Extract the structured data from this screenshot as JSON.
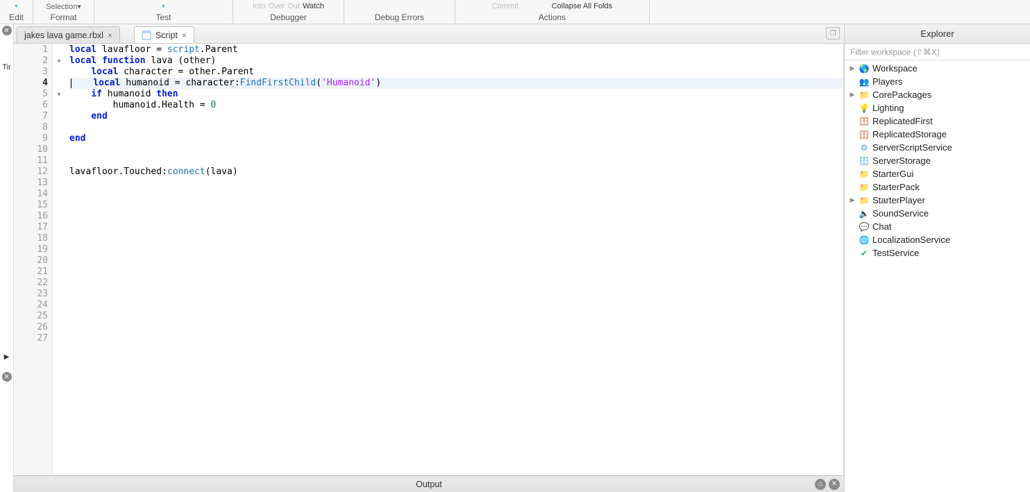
{
  "toolbar": {
    "groups": [
      {
        "label": "Edit",
        "icons": [
          "▾"
        ]
      },
      {
        "label": "Format",
        "icons": [
          "Selection▾"
        ]
      },
      {
        "label": "Test",
        "icons": [
          "▾"
        ]
      },
      {
        "label": "Debugger",
        "icons": [
          "Into",
          "Over",
          "Out",
          "Watch"
        ]
      },
      {
        "label": "Debug Errors",
        "icons": [
          ""
        ]
      },
      {
        "label": "Actions",
        "icons": [
          "Commit",
          "",
          "Collapse All Folds"
        ]
      }
    ]
  },
  "tabs": [
    {
      "label": "jakes lava game.rbxl",
      "active": false,
      "icon": "file"
    },
    {
      "label": "Script",
      "active": true,
      "icon": "script"
    }
  ],
  "leftRailText": "Tir",
  "code": {
    "currentLine": 4,
    "foldMarkers": {
      "2": "▼",
      "5": "▼"
    },
    "lines": [
      {
        "n": 1,
        "tokens": [
          [
            "kw",
            "local"
          ],
          [
            "id",
            " lavafloor "
          ],
          [
            "id",
            "= "
          ],
          [
            "mtd",
            "script"
          ],
          [
            "id",
            ".Parent"
          ]
        ]
      },
      {
        "n": 2,
        "tokens": [
          [
            "kw",
            "local function"
          ],
          [
            "id",
            " lava "
          ],
          [
            "id",
            "(other)"
          ]
        ]
      },
      {
        "n": 3,
        "tokens": [
          [
            "id",
            "    "
          ],
          [
            "kw",
            "local"
          ],
          [
            "id",
            " character "
          ],
          [
            "id",
            "= other.Parent"
          ]
        ]
      },
      {
        "n": 4,
        "hl": true,
        "tokens": [
          [
            "id",
            "    "
          ],
          [
            "kw",
            "local"
          ],
          [
            "id",
            " humanoid "
          ],
          [
            "id",
            "= character:"
          ],
          [
            "mtd",
            "FindFirstChild"
          ],
          [
            "id",
            "("
          ],
          [
            "str",
            "'Humanoid'"
          ],
          [
            "id",
            ")"
          ]
        ]
      },
      {
        "n": 5,
        "tokens": [
          [
            "id",
            "    "
          ],
          [
            "kw",
            "if"
          ],
          [
            "id",
            " humanoid "
          ],
          [
            "kw",
            "then"
          ]
        ]
      },
      {
        "n": 6,
        "tokens": [
          [
            "id",
            "        humanoid.Health "
          ],
          [
            "id",
            "= "
          ],
          [
            "num",
            "0"
          ]
        ]
      },
      {
        "n": 7,
        "tokens": [
          [
            "id",
            "    "
          ],
          [
            "kw",
            "end"
          ]
        ]
      },
      {
        "n": 8,
        "tokens": []
      },
      {
        "n": 9,
        "tokens": [
          [
            "kw",
            "end"
          ]
        ]
      },
      {
        "n": 10,
        "tokens": []
      },
      {
        "n": 11,
        "tokens": []
      },
      {
        "n": 12,
        "tokens": [
          [
            "id",
            "lavafloor.Touched:"
          ],
          [
            "mtd",
            "connect"
          ],
          [
            "id",
            "(lava)"
          ]
        ]
      },
      {
        "n": 13,
        "tokens": []
      },
      {
        "n": 14,
        "tokens": []
      },
      {
        "n": 15,
        "tokens": []
      },
      {
        "n": 16,
        "tokens": []
      },
      {
        "n": 17,
        "tokens": []
      },
      {
        "n": 18,
        "tokens": []
      },
      {
        "n": 19,
        "tokens": []
      },
      {
        "n": 20,
        "tokens": []
      },
      {
        "n": 21,
        "tokens": []
      },
      {
        "n": 22,
        "tokens": []
      },
      {
        "n": 23,
        "tokens": []
      },
      {
        "n": 24,
        "tokens": []
      },
      {
        "n": 25,
        "tokens": []
      },
      {
        "n": 26,
        "tokens": []
      },
      {
        "n": 27,
        "tokens": []
      }
    ]
  },
  "outputLabel": "Output",
  "explorer": {
    "title": "Explorer",
    "filterPlaceholder": "Filter workspace (⇧⌘X)",
    "nodes": [
      {
        "label": "Workspace",
        "expandable": true,
        "icon": "🌎",
        "iconClass": "ic-globe"
      },
      {
        "label": "Players",
        "expandable": false,
        "icon": "👥",
        "iconClass": "ic-players"
      },
      {
        "label": "CorePackages",
        "expandable": true,
        "icon": "📁",
        "iconClass": "ic-folder"
      },
      {
        "label": "Lighting",
        "expandable": false,
        "icon": "💡",
        "iconClass": "ic-light"
      },
      {
        "label": "ReplicatedFirst",
        "expandable": false,
        "icon": "🗄",
        "iconClass": "ic-box"
      },
      {
        "label": "ReplicatedStorage",
        "expandable": false,
        "icon": "🗄",
        "iconClass": "ic-box"
      },
      {
        "label": "ServerScriptService",
        "expandable": false,
        "icon": "⚙",
        "iconClass": "ic-storage"
      },
      {
        "label": "ServerStorage",
        "expandable": false,
        "icon": "🗄",
        "iconClass": "ic-storage"
      },
      {
        "label": "StarterGui",
        "expandable": false,
        "icon": "📁",
        "iconClass": "ic-folder"
      },
      {
        "label": "StarterPack",
        "expandable": false,
        "icon": "📁",
        "iconClass": "ic-folder"
      },
      {
        "label": "StarterPlayer",
        "expandable": true,
        "icon": "📁",
        "iconClass": "ic-folder"
      },
      {
        "label": "SoundService",
        "expandable": false,
        "icon": "🔈",
        "iconClass": "ic-sound"
      },
      {
        "label": "Chat",
        "expandable": false,
        "icon": "💬",
        "iconClass": "ic-chat"
      },
      {
        "label": "LocalizationService",
        "expandable": false,
        "icon": "🌐",
        "iconClass": "ic-loc"
      },
      {
        "label": "TestService",
        "expandable": false,
        "icon": "✔",
        "iconClass": "ic-test"
      }
    ]
  }
}
